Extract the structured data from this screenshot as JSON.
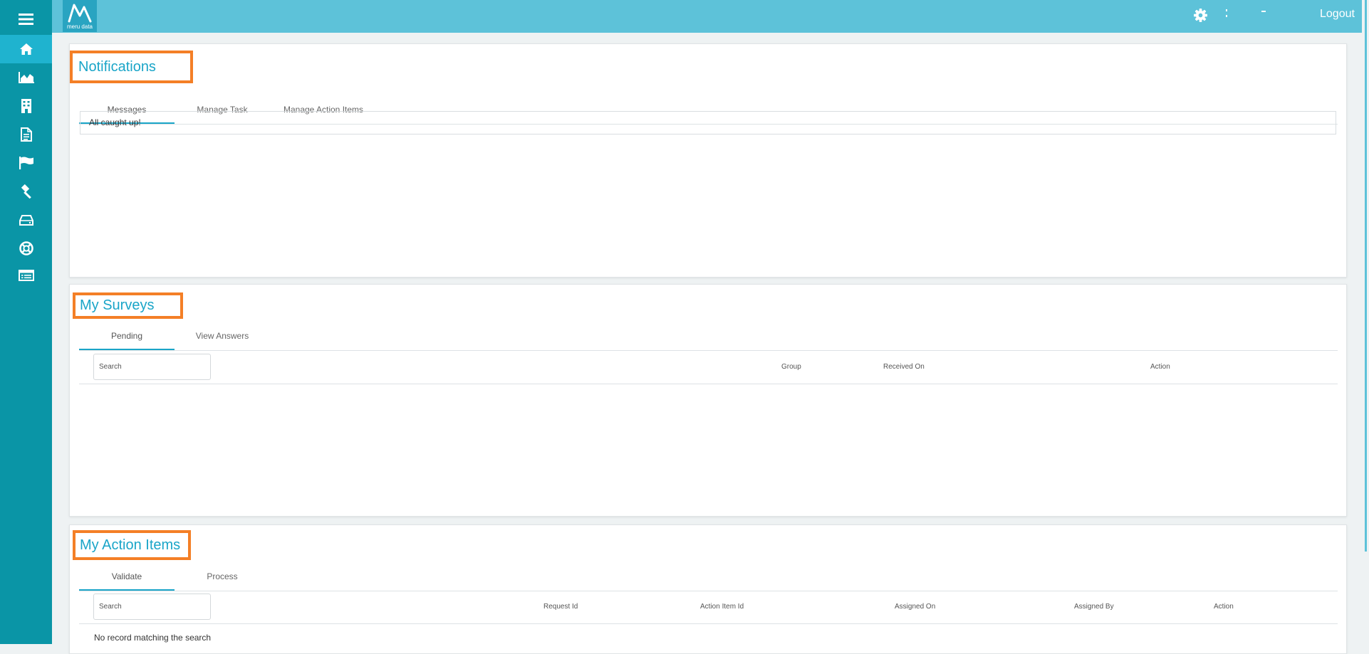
{
  "app": {
    "logo_text": "meru data",
    "logout_label": "Logout"
  },
  "sidebar": {
    "items": [
      {
        "icon": "menu-icon"
      },
      {
        "icon": "home-icon",
        "active": true
      },
      {
        "icon": "area-chart-icon"
      },
      {
        "icon": "building-icon"
      },
      {
        "icon": "document-icon"
      },
      {
        "icon": "flag-icon"
      },
      {
        "icon": "gavel-icon"
      },
      {
        "icon": "hard-drive-icon"
      },
      {
        "icon": "lifebuoy-icon"
      },
      {
        "icon": "list-icon"
      }
    ]
  },
  "topbar": {
    "icons": [
      "gear-icon"
    ]
  },
  "notifications": {
    "title": "Notifications",
    "tabs": [
      "Messages",
      "Manage Task",
      "Manage Action Items"
    ],
    "message": "All caught up!"
  },
  "surveys": {
    "title": "My Surveys",
    "tabs": [
      "Pending",
      "View Answers"
    ],
    "search_placeholder": "Search",
    "columns": [
      "Group",
      "Received On",
      "Action"
    ]
  },
  "action_items": {
    "title": "My Action Items",
    "tabs": [
      "Validate",
      "Process"
    ],
    "search_placeholder": "Search",
    "columns": [
      "Request Id",
      "Action Item Id",
      "Assigned On",
      "Assigned By",
      "Action"
    ],
    "empty_text": "No record matching the search"
  },
  "colors": {
    "sidebar": "#0a95a6",
    "topbar": "#5dc2d9",
    "accent": "#1aa5c8",
    "highlight": "#f47f26"
  }
}
